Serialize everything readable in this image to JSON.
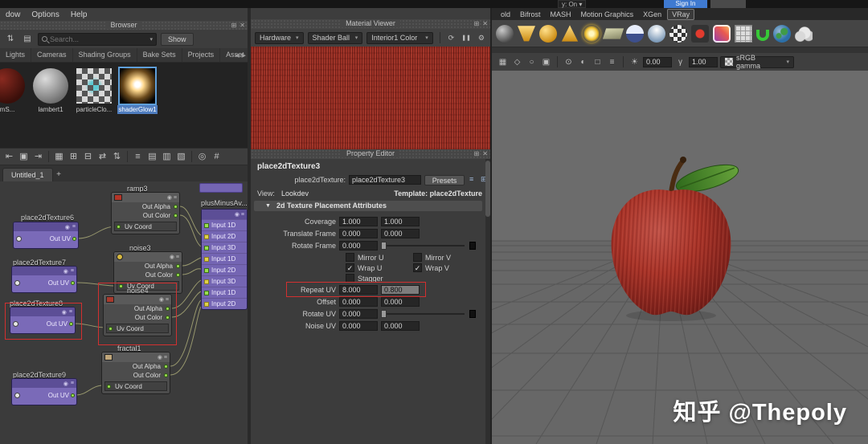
{
  "watermark_text": "知乎 @Thepoly",
  "icons": {
    "dropdown": "▾",
    "close": "✕",
    "float": "⊞",
    "scroll_left": "◀",
    "scroll_right": "▶",
    "check": "✓",
    "section_collapse": "▼",
    "node_dot": "◉",
    "node_menu": "≡",
    "search_sort": "⇅",
    "filter": "▤",
    "refresh": "⟳",
    "pause": "❚❚",
    "gear": "⚙",
    "exposure": "☀",
    "gamma": "γ"
  },
  "hypershade": {
    "menu_items": [
      "dow",
      "Options",
      "Help"
    ],
    "browser": {
      "title": "Browser",
      "search_placeholder": "Search...",
      "show_label": "Show",
      "tabs": [
        "Lights",
        "Cameras",
        "Shading Groups",
        "Bake Sets",
        "Projects",
        "Asset"
      ],
      "swatches": [
        {
          "label": "mS..."
        },
        {
          "label": "lambert1"
        },
        {
          "label": "particleClo..."
        },
        {
          "label": "shaderGlow1"
        }
      ]
    },
    "graph": {
      "toolbar": [
        {
          "n": "rearrange-graph-icon",
          "g": "⇤"
        },
        {
          "n": "graph-selection-icon",
          "g": "▣"
        },
        {
          "n": "frame-graph-icon",
          "g": "⇥"
        },
        {
          "n": "grid-layout-icon",
          "g": "▦"
        },
        {
          "n": "add-selected-icon",
          "g": "⊞"
        },
        {
          "n": "remove-selected-icon",
          "g": "⊟"
        },
        {
          "n": "input-connections-icon",
          "g": "⇄"
        },
        {
          "n": "input-output-connections-icon",
          "g": "⇅"
        },
        {
          "n": "pin-selection-icon",
          "g": "≡"
        },
        {
          "n": "align-left-icon",
          "g": "▤"
        },
        {
          "n": "align-middle-icon",
          "g": "▥"
        },
        {
          "n": "distribute-icon",
          "g": "▧"
        },
        {
          "n": "search-graph-icon",
          "g": "◎"
        },
        {
          "n": "toggle-snap-icon",
          "g": "#"
        }
      ],
      "tab_label": "Untitled_1",
      "add_tab_label": "+",
      "nodes": {
        "p2d6": {
          "title": "place2dTexture6",
          "out": "Out UV"
        },
        "p2d7": {
          "title": "place2dTexture7",
          "out": "Out UV"
        },
        "p2d8": {
          "title": "place2dTexture8",
          "out": "Out UV"
        },
        "p2d9": {
          "title": "place2dTexture9",
          "out": "Out UV"
        },
        "ramp3": {
          "title": "ramp3",
          "out_alpha": "Out Alpha",
          "out_color": "Out Color",
          "in_uv": "Uv Coord"
        },
        "noise3": {
          "title": "noise3",
          "out_alpha": "Out Alpha",
          "out_color": "Out Color",
          "in_uv": "Uv Coord"
        },
        "noise4": {
          "title": "noise4",
          "out_alpha": "Out Alpha",
          "out_color": "Out Color",
          "in_uv": "Uv Coord"
        },
        "fractal1": {
          "title": "fractal1",
          "out_alpha": "Out Alpha",
          "out_color": "Out Color",
          "in_uv": "Uv Coord"
        },
        "plus": {
          "title": "plusMinusAv...",
          "inputs": [
            "Input 1D",
            "Input 2D",
            "Input 3D",
            "Input 1D",
            "Input 2D",
            "Input 3D",
            "Input 1D",
            "Input 2D"
          ]
        }
      }
    }
  },
  "material_viewer": {
    "title": "Material Viewer",
    "renderer": "Hardware",
    "geometry": "Shader Ball",
    "environment": "Interior1 Color"
  },
  "property_editor": {
    "title": "Property Editor",
    "node_name": "place2dTexture3",
    "name_label": "place2dTexture:",
    "name_value": "place2dTexture3",
    "presets_label": "Presets",
    "view_label": "View:",
    "view_value": "Lookdev",
    "template_label": "Template: place2dTexture",
    "section_title": "2d Texture Placement Attributes",
    "fields": {
      "coverage": {
        "label": "Coverage",
        "u": "1.000",
        "v": "1.000"
      },
      "translate_frame": {
        "label": "Translate Frame",
        "u": "0.000",
        "v": "0.000"
      },
      "rotate_frame": {
        "label": "Rotate Frame",
        "u": "0.000"
      },
      "mirror_u": {
        "label": "Mirror U",
        "checked": false
      },
      "mirror_v": {
        "label": "Mirror V",
        "checked": false
      },
      "wrap_u": {
        "label": "Wrap U",
        "checked": true
      },
      "wrap_v": {
        "label": "Wrap V",
        "checked": true
      },
      "stagger": {
        "label": "Stagger",
        "checked": false
      },
      "repeat_uv": {
        "label": "Repeat UV",
        "u": "8.000",
        "v": "0.800"
      },
      "offset": {
        "label": "Offset",
        "u": "0.000",
        "v": "0.000"
      },
      "rotate_uv": {
        "label": "Rotate UV",
        "u": "0.000"
      },
      "noise_uv": {
        "label": "Noise UV",
        "u": "0.000",
        "v": "0.000"
      }
    }
  },
  "main_window": {
    "account_menu": "y: On",
    "sign_in_label": "Sign In",
    "menu_items": [
      "old",
      "Bifrost",
      "MASH",
      "Motion Graphics",
      "XGen",
      "VRay"
    ],
    "toolbar": {
      "icons": [
        {
          "n": "snap-grid-icon",
          "g": "▦"
        },
        {
          "n": "snap-curve-icon",
          "g": "◇"
        },
        {
          "n": "snap-point-icon",
          "g": "○"
        },
        {
          "n": "snap-plane-icon",
          "g": "▣"
        },
        {
          "n": "make-live-icon",
          "g": "⊙"
        },
        {
          "n": "history-icon",
          "g": "◐"
        },
        {
          "n": "construction-icon",
          "g": "□"
        },
        {
          "n": "list-inputs-icon",
          "g": "≡"
        }
      ],
      "exposure_value": "0.00",
      "gamma_value": "1.00",
      "view_transform": "sRGB gamma"
    },
    "shelf_icons": [
      "shaded-sphere",
      "funnel",
      "sphere",
      "cone",
      "sun",
      "plane",
      "disc",
      "half-sphere",
      "checker-sphere",
      "record",
      "photo",
      "spreadsheet",
      "magnet",
      "earth",
      "cloud"
    ]
  }
}
